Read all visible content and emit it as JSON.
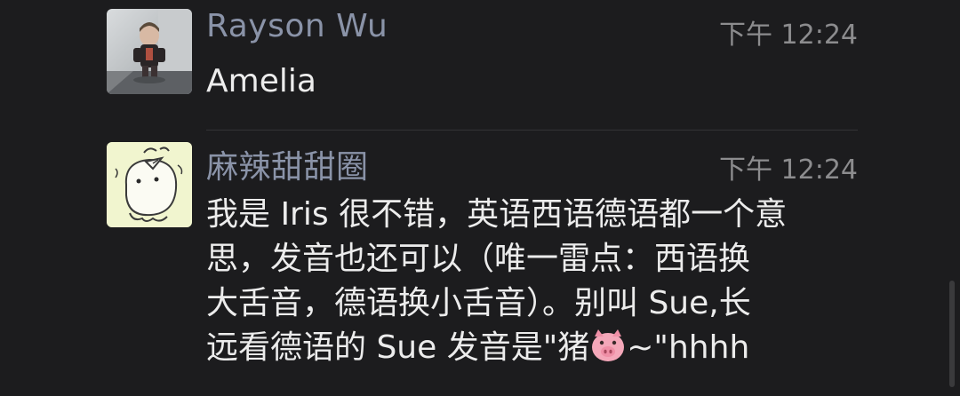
{
  "messages": [
    {
      "sender": "Rayson Wu",
      "time": "下午 12:24",
      "lines": [
        "Amelia"
      ],
      "avatar_icon": "doll-photo-avatar"
    },
    {
      "sender": "麻辣甜甜圈",
      "time": "下午 12:24",
      "lines": [
        "我是 Iris 很不错，英语西语德语都一个意",
        "思，发音也还可以（唯一雷点：西语换",
        "大舌音，德语换小舌音）。别叫 Sue,长",
        "远看德语的 Sue 发音是\"猪",
        "~\"hhhh"
      ],
      "emoji_icon": "pig-face-icon",
      "avatar_icon": "doodle-chick-avatar"
    }
  ],
  "colors": {
    "background": "#1c1c1e",
    "sender": "#8a93a8",
    "text": "#ececec",
    "time": "#8c8c8e"
  }
}
